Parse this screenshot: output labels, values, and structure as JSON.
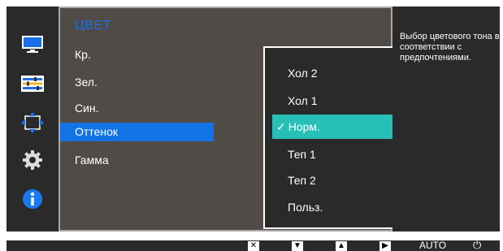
{
  "menu": {
    "title": "ЦВЕТ",
    "items": [
      {
        "label": "Кр.",
        "active": false
      },
      {
        "label": "Зел.",
        "active": false
      },
      {
        "label": "Син.",
        "active": false
      },
      {
        "label": "Оттенок",
        "active": true
      },
      {
        "label": "Гамма",
        "active": false
      }
    ]
  },
  "submenu": {
    "items": [
      {
        "label": "Хол 2",
        "selected": false
      },
      {
        "label": "Хол 1",
        "selected": false
      },
      {
        "label": "Норм.",
        "selected": true
      },
      {
        "label": "Теп 1",
        "selected": false
      },
      {
        "label": "Теп 2",
        "selected": false
      },
      {
        "label": "Польз.",
        "selected": false
      }
    ],
    "check_glyph": "✓"
  },
  "description": "Выбор цветового тона в соответствии с предпочтениями.",
  "nav_icons": [
    "monitor-icon",
    "sliders-icon",
    "position-icon",
    "gear-icon",
    "info-icon"
  ],
  "bottom_bar": {
    "keys": [
      {
        "name": "close-key",
        "glyph": "✕"
      },
      {
        "name": "down-key",
        "glyph": "▼"
      },
      {
        "name": "up-key",
        "glyph": "▲"
      },
      {
        "name": "right-key",
        "glyph": "▶"
      }
    ],
    "auto_label": "AUTO",
    "power_glyph": "⏻"
  },
  "colors": {
    "accent_blue": "#1273e6",
    "title_blue": "#1a6ee6",
    "selected_teal": "#27bfb6",
    "panel_brown": "#504b47",
    "osd_dark": "#2a2a2a"
  }
}
